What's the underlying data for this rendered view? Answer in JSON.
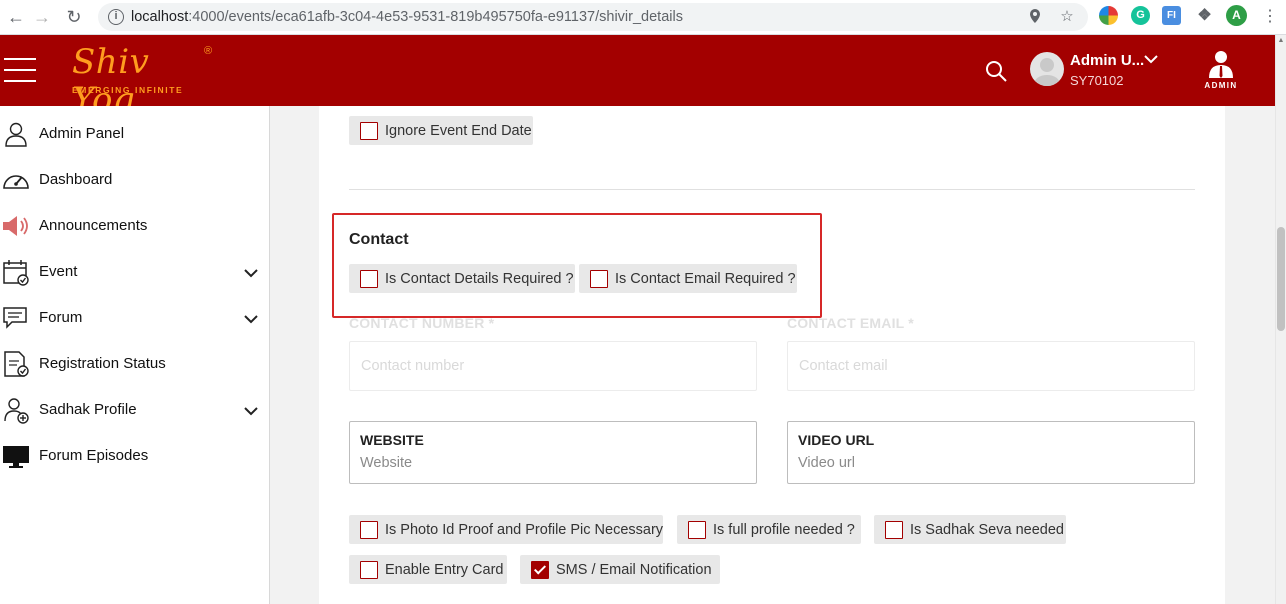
{
  "browser": {
    "url_host": "localhost",
    "url_rest": ":4000/events/eca61afb-3c04-4e53-9531-819b495750fa-e91137/shivir_details",
    "profile_initial": "A",
    "ext_letter": "G"
  },
  "header": {
    "brand": "Shiv Yog",
    "reg": "®",
    "tagline": "EMERGING INFINITE",
    "user_name": "Admin U...",
    "user_id": "SY70102",
    "admin_label": "ADMIN",
    "colors": {
      "primary": "#a30000",
      "accent": "#ff9d1f"
    }
  },
  "sidebar": {
    "items": [
      {
        "label": "Admin Panel",
        "icon": "user-icon",
        "expandable": false
      },
      {
        "label": "Dashboard",
        "icon": "speedometer-icon",
        "expandable": false
      },
      {
        "label": "Announcements",
        "icon": "megaphone-icon",
        "expandable": false
      },
      {
        "label": "Event",
        "icon": "calendar-icon",
        "expandable": true
      },
      {
        "label": "Forum",
        "icon": "chat-icon",
        "expandable": true
      },
      {
        "label": "Registration Status",
        "icon": "document-check-icon",
        "expandable": false
      },
      {
        "label": "Sadhak Profile",
        "icon": "user-add-icon",
        "expandable": true
      },
      {
        "label": "Forum Episodes",
        "icon": "monitor-icon",
        "expandable": false
      }
    ]
  },
  "form": {
    "ignore_end_date": {
      "label": "Ignore Event End Date",
      "checked": false
    },
    "contact": {
      "title": "Contact",
      "details_required": {
        "label": "Is Contact Details Required ?",
        "checked": false
      },
      "email_required": {
        "label": "Is Contact Email Required ?",
        "checked": false
      }
    },
    "contact_number": {
      "label": "CONTACT NUMBER *",
      "placeholder": "Contact number"
    },
    "contact_email": {
      "label": "CONTACT EMAIL *",
      "placeholder": "Contact email"
    },
    "website": {
      "label": "WEBSITE",
      "placeholder": "Website"
    },
    "video_url": {
      "label": "VIDEO URL",
      "placeholder": "Video url"
    },
    "options": [
      {
        "label": "Is Photo Id Proof and Profile Pic Necessary",
        "checked": false
      },
      {
        "label": "Is full profile needed ?",
        "checked": false
      },
      {
        "label": "Is Sadhak Seva needed",
        "checked": false
      },
      {
        "label": "Enable Entry Card",
        "checked": false
      },
      {
        "label": "SMS / Email Notification",
        "checked": true
      }
    ]
  }
}
